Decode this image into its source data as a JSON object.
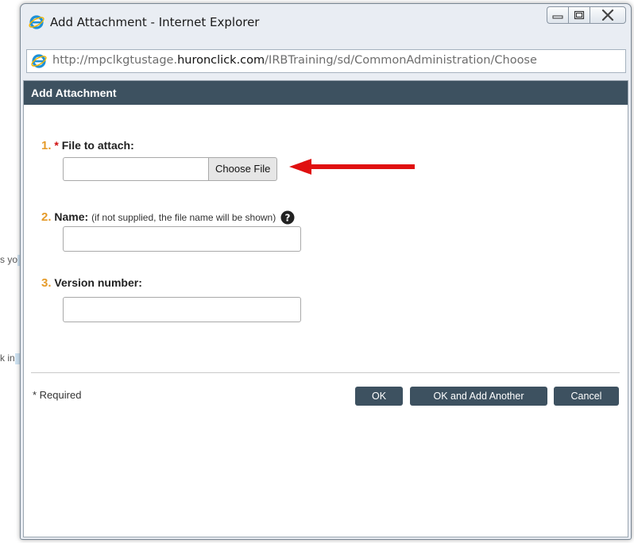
{
  "background": {
    "fragment_1": "s yo",
    "fragment_2": "k in"
  },
  "window": {
    "title": "Add Attachment - Internet Explorer",
    "icon": "internet-explorer-icon",
    "controls": [
      "minimize-icon",
      "maximize-icon",
      "close-icon"
    ]
  },
  "address_bar": {
    "url_prefix": "http://mpclkgtustage.",
    "url_domain": "huronclick.com",
    "url_suffix": "/IRBTraining/sd/CommonAdministration/Choose"
  },
  "dialog": {
    "header": "Add Attachment",
    "fields": [
      {
        "number": "1.",
        "required_mark": "*",
        "label": "File to attach:",
        "button": "Choose File",
        "value": ""
      },
      {
        "number": "2.",
        "label": "Name:",
        "hint": "(if not supplied, the file name will be shown)",
        "value": ""
      },
      {
        "number": "3.",
        "label": "Version number:",
        "value": ""
      }
    ],
    "required_note": "* Required",
    "buttons": {
      "ok": "OK",
      "ok_add_another": "OK and Add Another",
      "cancel": "Cancel"
    }
  },
  "colors": {
    "header_bg": "#3d5160",
    "step_number": "#e59b2a",
    "required": "#d01010",
    "annotation_arrow": "#e01010"
  }
}
